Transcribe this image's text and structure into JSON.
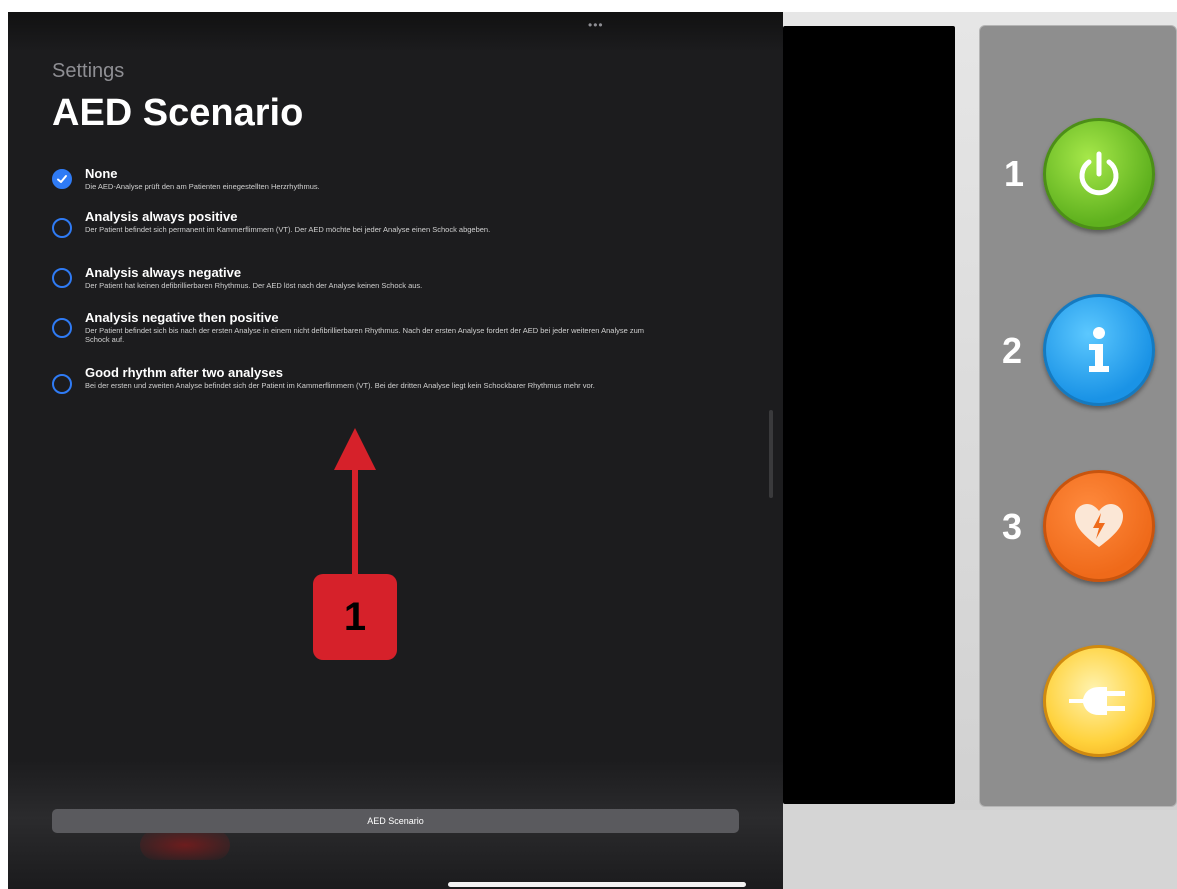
{
  "header": {
    "breadcrumb": "Settings",
    "title": "AED Scenario"
  },
  "options": [
    {
      "title": "None",
      "description": "Die AED-Analyse prüft den am Patienten einegestellten Herzrhythmus.",
      "selected": true
    },
    {
      "title": "Analysis always positive",
      "description": "Der Patient befindet sich permanent im Kammerflimmern (VT). Der AED möchte bei jeder Analyse einen Schock abgeben.",
      "selected": false
    },
    {
      "title": "Analysis always negative",
      "description": "Der Patient hat keinen defibrillierbaren Rhythmus. Der AED löst nach der Analyse keinen Schock aus.",
      "selected": false
    },
    {
      "title": "Analysis negative then positive",
      "description": "Der Patient befindet sich bis nach der ersten Analyse in einem nicht defibrillierbaren Rhythmus. Nach der ersten Analyse fordert der AED bei jeder weiteren Analyse zum Schock auf.",
      "selected": false
    },
    {
      "title": "Good rhythm after two analyses",
      "description": "Bei der ersten und zweiten Analyse befindet sich der Patient im Kammerflimmern (VT). Bei der dritten Analyse liegt kein Schockbarer Rhythmus mehr vor.",
      "selected": false
    }
  ],
  "annotation": {
    "badge": "1"
  },
  "tab_bar": {
    "label": "AED Scenario"
  },
  "device": {
    "buttons": [
      {
        "number": "1",
        "icon": "power-icon",
        "color": "#6cc224"
      },
      {
        "number": "2",
        "icon": "info-icon",
        "color": "#229ef0"
      },
      {
        "number": "3",
        "icon": "heart-shock-icon",
        "color": "#f06c1b"
      },
      {
        "number": "",
        "icon": "plug-icon",
        "color": "#ffd23c"
      }
    ]
  },
  "colors": {
    "accent": "#2f7bf5",
    "annotation": "#d6212a",
    "sheet_background": "#1c1c1e"
  }
}
